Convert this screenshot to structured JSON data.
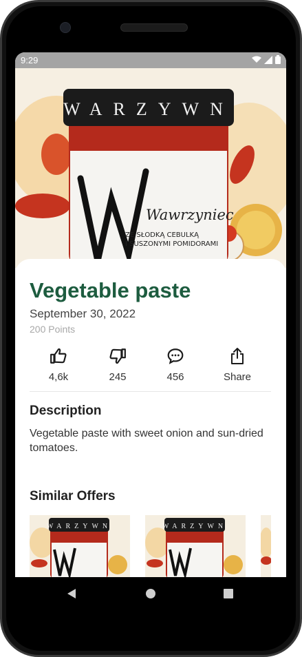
{
  "status_bar": {
    "time": "9:29"
  },
  "product": {
    "title": "Vegetable paste",
    "date": "September 30, 2022",
    "points": "200 Points",
    "label_brand": "WARZYWN",
    "label_script": "Wawrzyniec",
    "label_line1": "ZE SŁODKĄ CEBULKĄ",
    "label_line2": "I SUSZONYMI POMIDORAMI"
  },
  "actions": {
    "like": {
      "label": "4,6k",
      "icon": "thumbs-up-icon"
    },
    "dislike": {
      "label": "245",
      "icon": "thumbs-down-icon"
    },
    "comments": {
      "label": "456",
      "icon": "comment-icon"
    },
    "share": {
      "label": "Share",
      "icon": "share-icon"
    }
  },
  "description": {
    "heading": "Description",
    "text": "Vegetable paste with sweet onion and sun-dried tomatoes."
  },
  "similar": {
    "heading": "Similar Offers"
  },
  "colors": {
    "title_green": "#1d5c3f",
    "statusbar": "#a4a4a4",
    "jar_red": "#b42a1c"
  }
}
